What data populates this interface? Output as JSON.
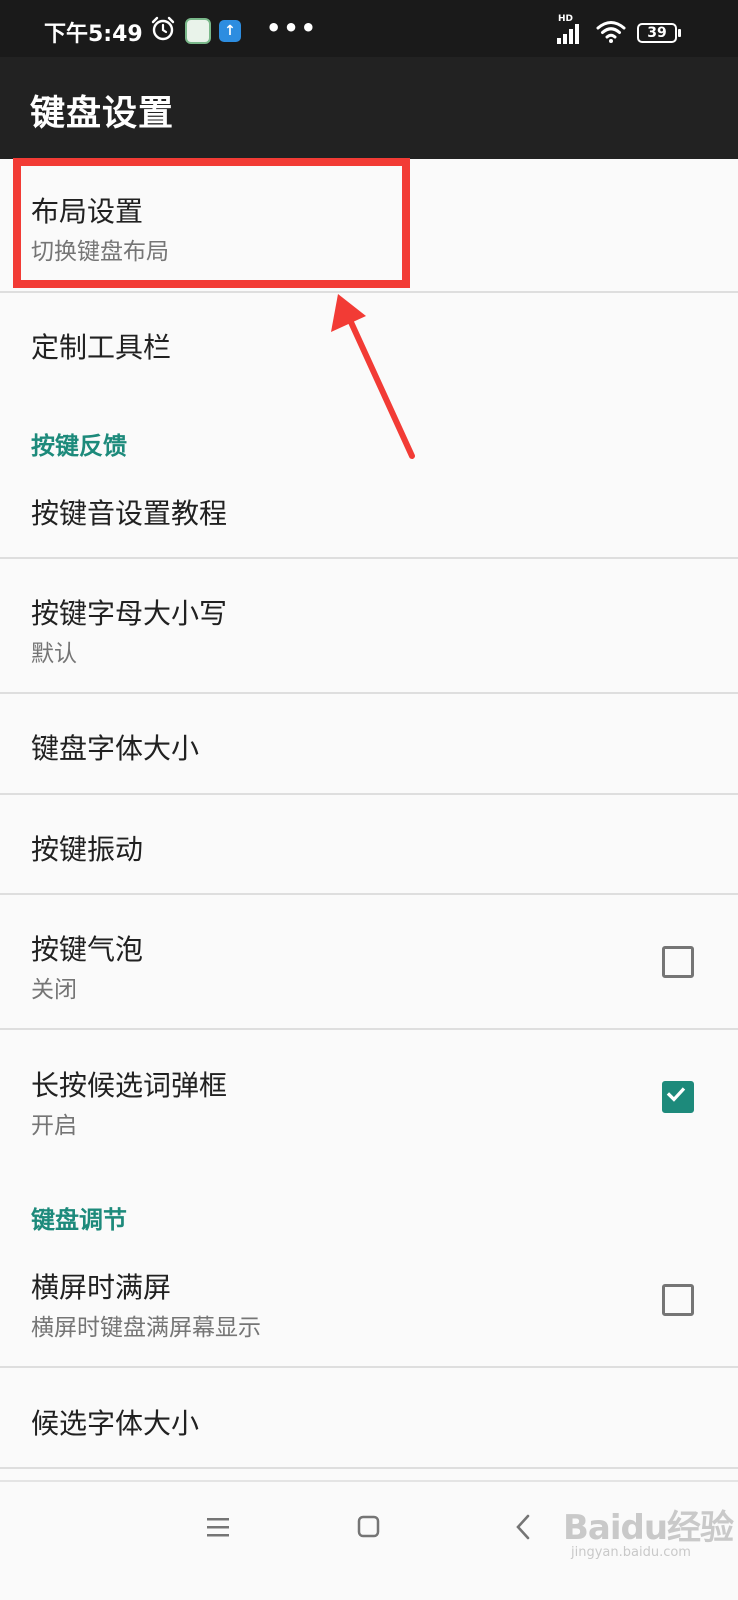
{
  "status_bar": {
    "time": "下午5:49",
    "more_indicator": "•••",
    "network_label": "HD",
    "battery_level": "39",
    "icons": [
      "alarm-icon",
      "app-notification-icon",
      "upload-icon",
      "signal-icon",
      "wifi-icon",
      "battery-icon"
    ]
  },
  "app_bar": {
    "title": "键盘设置"
  },
  "settings": {
    "layout": {
      "title": "布局设置",
      "summary": "切换键盘布局"
    },
    "toolbar": {
      "title": "定制工具栏"
    },
    "section_feedback": "按键反馈",
    "key_sound": {
      "title": "按键音设置教程"
    },
    "key_case": {
      "title": "按键字母大小写",
      "summary": "默认"
    },
    "font_size": {
      "title": "键盘字体大小"
    },
    "vibration": {
      "title": "按键振动"
    },
    "bubble": {
      "title": "按键气泡",
      "summary": "关闭",
      "checked": false
    },
    "long_press": {
      "title": "长按候选词弹框",
      "summary": "开启",
      "checked": true
    },
    "section_adjust": "键盘调节",
    "fullscreen": {
      "title": "横屏时满屏",
      "summary": "横屏时键盘满屏幕显示",
      "checked": false
    },
    "candidate_font": {
      "title": "候选字体大小"
    }
  },
  "annotation": {
    "color": "#f23b35"
  },
  "watermark": {
    "brand": "Baidu经验",
    "url": "jingyan.baidu.com"
  },
  "nav_bar": {
    "icons": [
      "menu-icon",
      "home-icon",
      "back-icon"
    ]
  },
  "colors": {
    "accent": "#1d8a7b",
    "app_bar": "#222222",
    "background": "#fafafa"
  }
}
